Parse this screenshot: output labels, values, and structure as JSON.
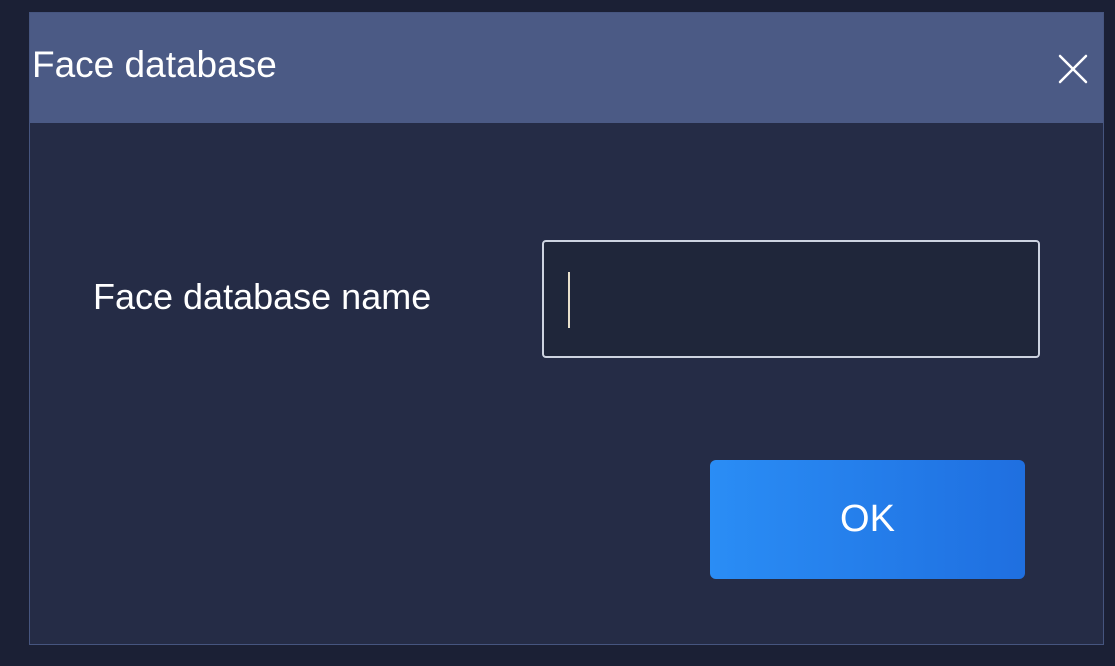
{
  "dialog": {
    "title": "Face database",
    "close_icon": "close-icon",
    "field": {
      "label": "Face database name",
      "value": "",
      "placeholder": ""
    },
    "ok_label": "OK"
  },
  "colors": {
    "background": "#1b2035",
    "dialog_body": "#252c46",
    "titlebar": "#4b5a85",
    "input_background": "#1f263a",
    "input_border": "#cdd3e0",
    "button": "#2a8df5",
    "text": "#ffffff"
  }
}
